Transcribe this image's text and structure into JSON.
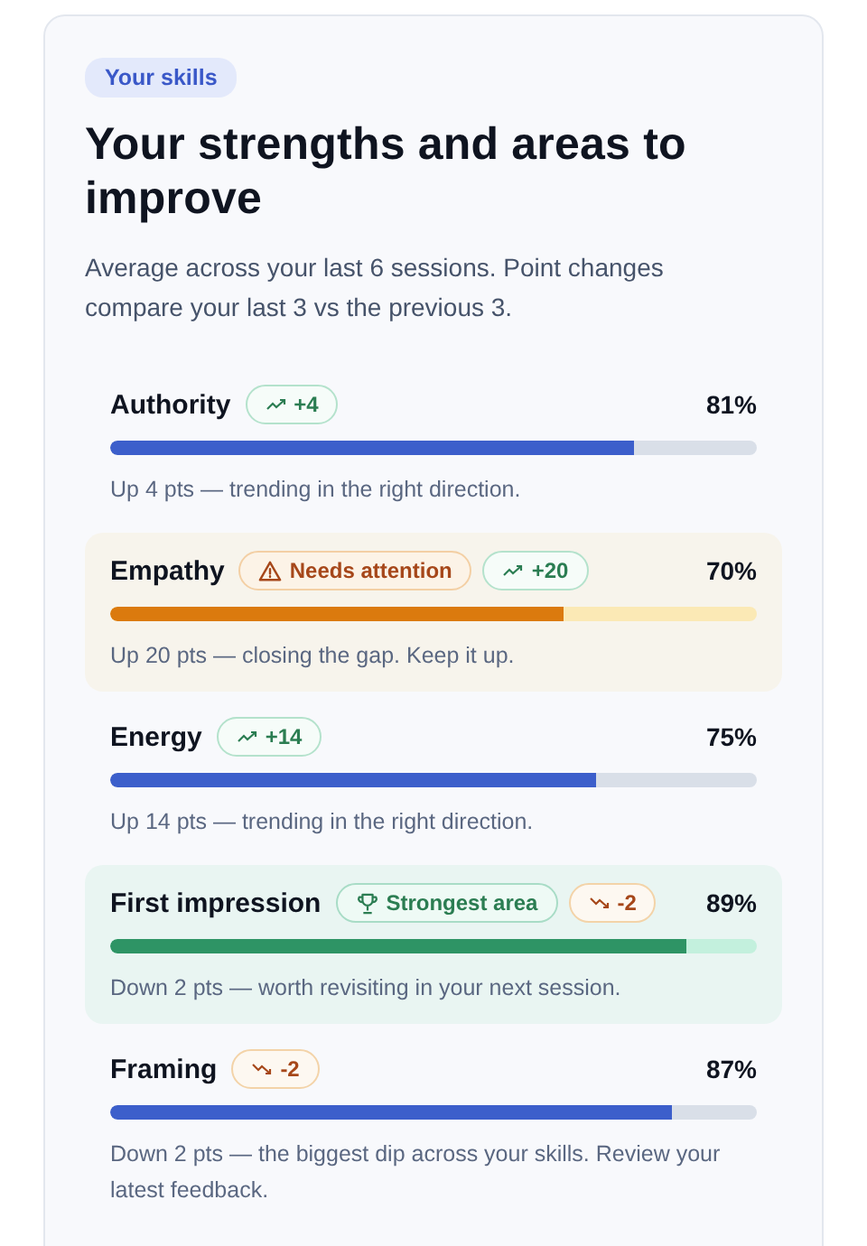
{
  "tag": "Your skills",
  "title": "Your strengths and areas to improve",
  "subtitle": "Average across your last 6 sessions. Point changes compare your last 3 vs the previous 3.",
  "skills": [
    {
      "name": "Authority",
      "kind": "normal",
      "rising": true,
      "change": "+4",
      "percent": "81%",
      "level": 0.81,
      "note": "Up 4 pts — trending in the right direction."
    },
    {
      "name": "Empathy",
      "kind": "attention",
      "status": "Needs attention",
      "rising": true,
      "change": "+20",
      "percent": "70%",
      "level": 0.7,
      "note": "Up 20 pts — closing the gap. Keep it up."
    },
    {
      "name": "Energy",
      "kind": "normal",
      "rising": true,
      "change": "+14",
      "percent": "75%",
      "level": 0.75,
      "note": "Up 14 pts — trending in the right direction."
    },
    {
      "name": "First impression",
      "kind": "strongest",
      "status": "Strongest area",
      "rising": false,
      "change": "-2",
      "percent": "89%",
      "level": 0.89,
      "note": "Down 2 pts — worth revisiting in your next session."
    },
    {
      "name": "Framing",
      "kind": "normal",
      "rising": false,
      "change": "-2",
      "percent": "87%",
      "level": 0.87,
      "note": "Down 2 pts — the biggest dip across your skills. Review your latest feedback."
    }
  ]
}
